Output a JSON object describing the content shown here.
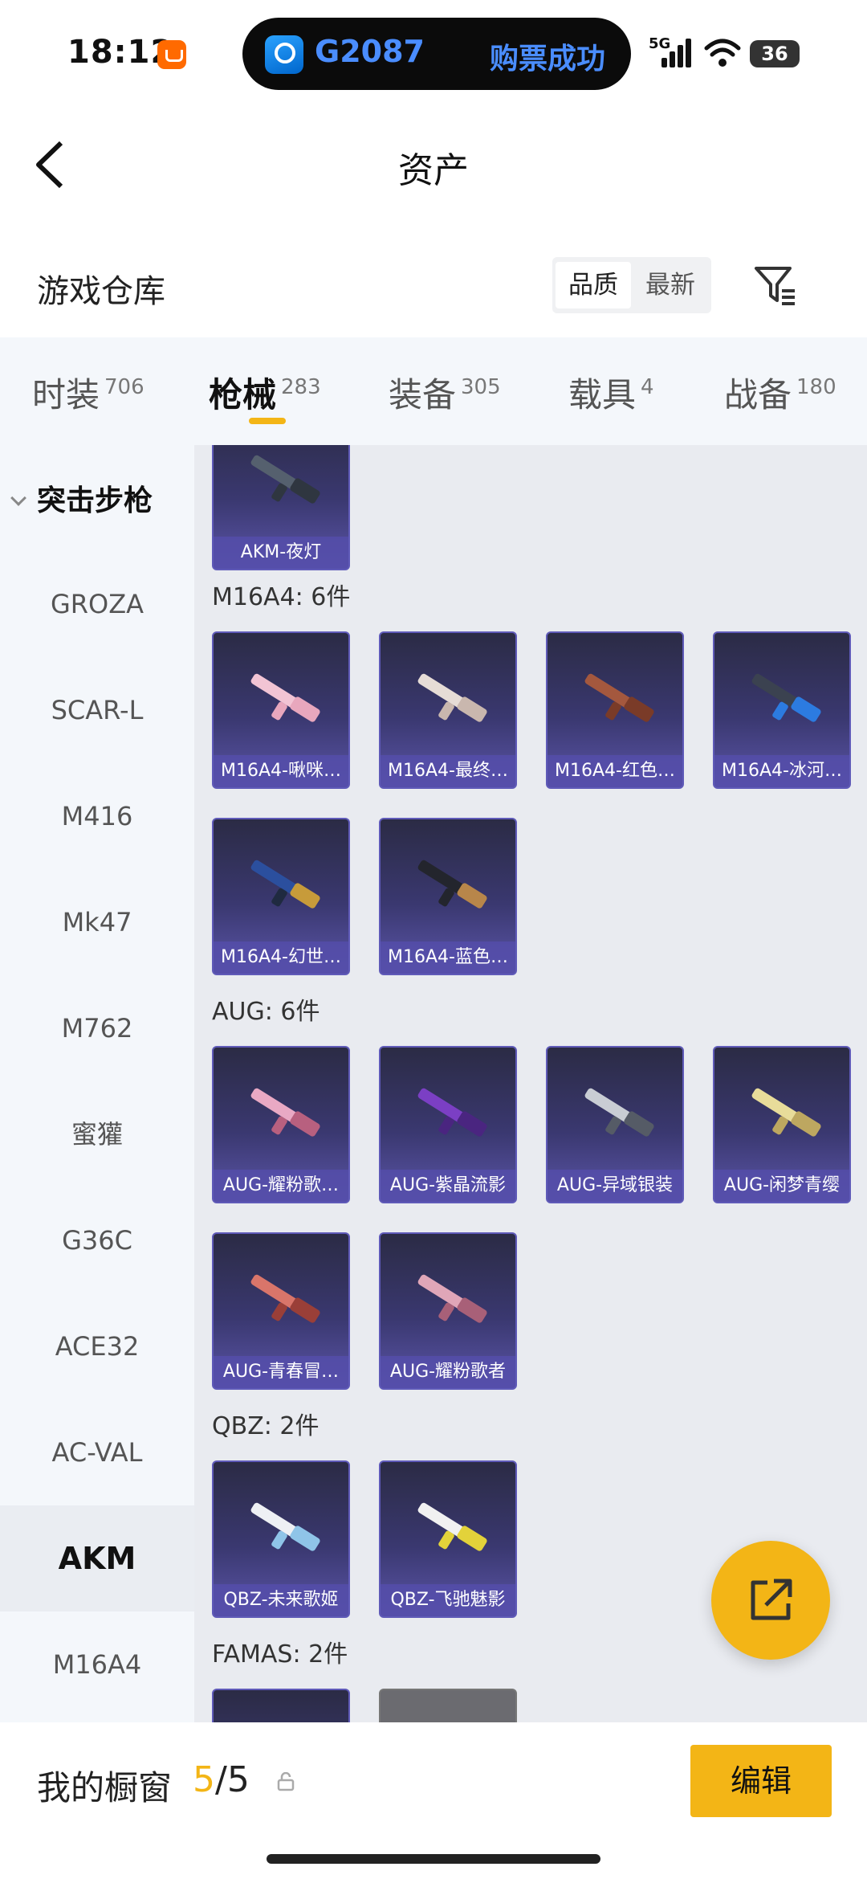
{
  "status_bar": {
    "time": "18:12",
    "island": {
      "train": "G2087",
      "message": "购票成功"
    },
    "network": "5G",
    "battery": "36"
  },
  "nav": {
    "title": "资产"
  },
  "warehouse": {
    "title": "游戏仓库",
    "sort_options": [
      "品质",
      "最新"
    ],
    "sort_selected": "品质"
  },
  "tabs": [
    {
      "label": "时装",
      "count": "706"
    },
    {
      "label": "枪械",
      "count": "283"
    },
    {
      "label": "装备",
      "count": "305"
    },
    {
      "label": "载具",
      "count": "4"
    },
    {
      "label": "战备",
      "count": "180"
    }
  ],
  "active_tab": "枪械",
  "sidebar": {
    "header": "突击步枪",
    "items": [
      "GROZA",
      "SCAR-L",
      "M416",
      "Mk47",
      "M762",
      "蜜獾",
      "G36C",
      "ACE32",
      "AC-VAL",
      "AKM",
      "M16A4"
    ],
    "active": "AKM"
  },
  "content": {
    "akm_card": "AKM-夜灯",
    "sections": [
      {
        "title": "M16A4: 6件",
        "items": [
          "M16A4-啾咪…",
          "M16A4-最终…",
          "M16A4-红色…",
          "M16A4-冰河…",
          "M16A4-幻世…",
          "M16A4-蓝色…"
        ]
      },
      {
        "title": "AUG: 6件",
        "items": [
          "AUG-耀粉歌…",
          "AUG-紫晶流影",
          "AUG-异域银装",
          "AUG-闲梦青缨",
          "AUG-青春冒…",
          "AUG-耀粉歌者"
        ]
      },
      {
        "title": "QBZ: 2件",
        "items": [
          "QBZ-未来歌姬",
          "QBZ-飞驰魅影"
        ]
      },
      {
        "title": "FAMAS: 2件",
        "items": []
      }
    ]
  },
  "bottom": {
    "showcase_label": "我的橱窗",
    "showcase_used": "5",
    "showcase_total": "/5",
    "edit_label": "编辑"
  },
  "colors": {
    "accent": "#f3b516",
    "card_bg": "#3a3870",
    "card_caption": "#554eaa"
  },
  "icons": [
    "back-arrow-icon",
    "filter-icon",
    "share-icon",
    "lock-icon"
  ]
}
